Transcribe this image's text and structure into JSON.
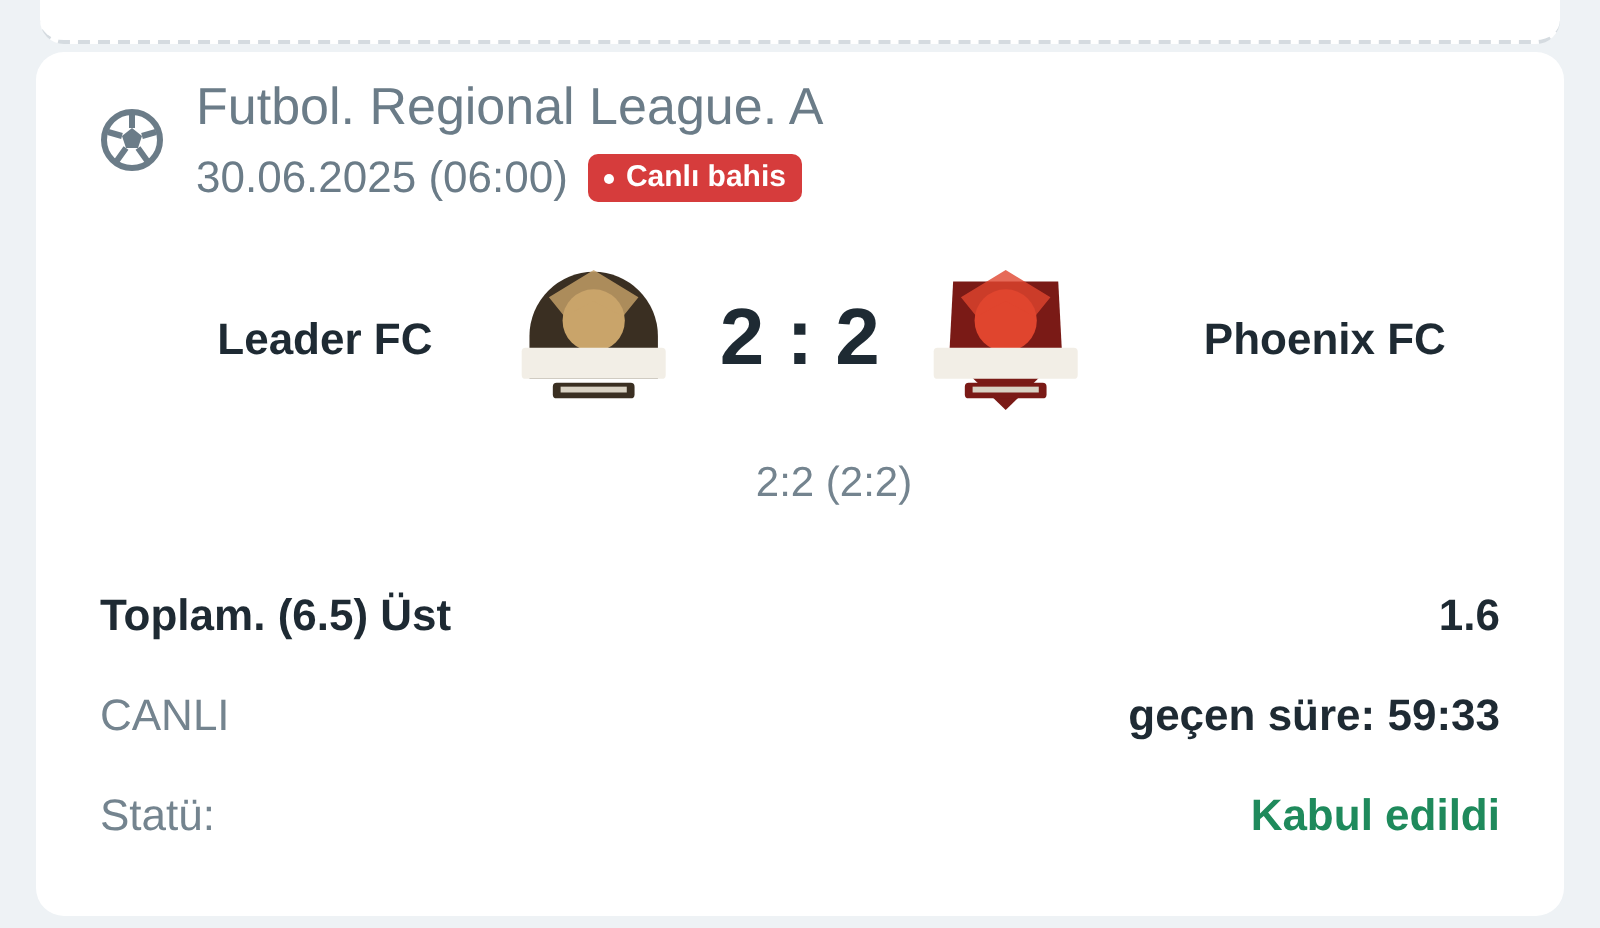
{
  "event": {
    "sport": "Futbol. Regional League. A",
    "date": "30.06.2025 (06:00)",
    "badge": {
      "label": "Canlı bahis",
      "live": true
    }
  },
  "match": {
    "home": {
      "name": "Leader FC"
    },
    "score": "2 : 2",
    "away": {
      "name": "Phoenix FC"
    },
    "detail": "2:2 (2:2)"
  },
  "bet": [
    {
      "label": "Toplam. (6.5) Üst",
      "value": "1.6",
      "kind": "strong"
    },
    {
      "label": "CANLI",
      "value": "geçen süre: 59:33",
      "kind": "info"
    },
    {
      "label": "Statü:",
      "value": "Kabul edildi",
      "kind": "status",
      "color": "#1f8a5c"
    }
  ]
}
